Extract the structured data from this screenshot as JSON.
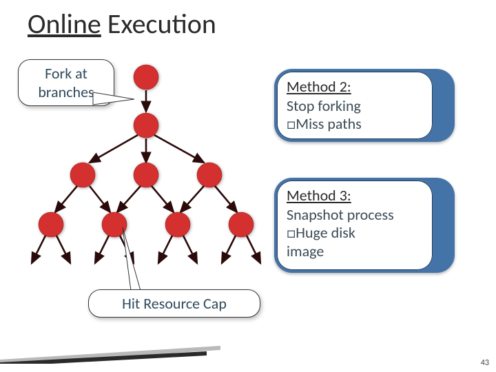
{
  "title": {
    "underlined": "Online",
    "rest": " Execution"
  },
  "callouts": {
    "fork": {
      "line1": "Fork at",
      "line2": "branches"
    },
    "hit": "Hit Resource Cap"
  },
  "methods": {
    "m2": {
      "title": "Method 2:",
      "line1": "Stop forking",
      "line2": "□Miss paths"
    },
    "m3": {
      "title": "Method 3:",
      "line1": "Snapshot process",
      "line2": "□Huge disk",
      "line3": "image"
    }
  },
  "page_number": "43",
  "chart_data": {
    "type": "diagram",
    "description": "Binary tree of red nodes showing forking at branches; level 0: 1 node; level 1: 1 node; level 2: 3-fan; level 3: 4 nodes; level 4: 8 leaf arrows with no nodes",
    "annotations": [
      {
        "label": "Fork at branches",
        "points_to": "root-to-child edge"
      },
      {
        "label": "Hit Resource Cap",
        "points_to": "third-row node"
      }
    ],
    "side_boxes": [
      "Method 2: Stop forking — Miss paths",
      "Method 3: Snapshot process — Huge disk image"
    ]
  }
}
